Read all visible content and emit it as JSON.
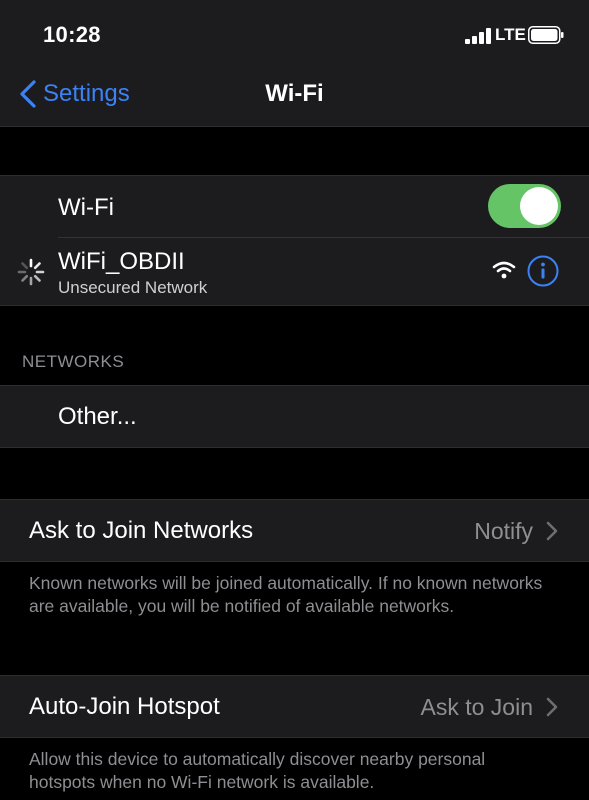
{
  "status_bar": {
    "time": "10:28",
    "network": "LTE"
  },
  "nav": {
    "back_label": "Settings",
    "title": "Wi-Fi"
  },
  "wifi_toggle": {
    "label": "Wi-Fi",
    "on": true,
    "color": "#65c466"
  },
  "current_network": {
    "name": "WiFi_OBDII",
    "security": "Unsecured Network"
  },
  "networks_section": {
    "header": "NETWORKS",
    "other_label": "Other..."
  },
  "ask_to_join": {
    "label": "Ask to Join Networks",
    "value": "Notify",
    "footnote": "Known networks will be joined automatically. If no known networks are available, you will be notified of available networks."
  },
  "auto_join_hotspot": {
    "label": "Auto-Join Hotspot",
    "value": "Ask to Join",
    "footnote": "Allow this device to automatically discover nearby personal hotspots when no Wi-Fi network is available."
  },
  "colors": {
    "accent": "#3b82f6",
    "background": "#000000",
    "cell": "#1c1c1e"
  }
}
